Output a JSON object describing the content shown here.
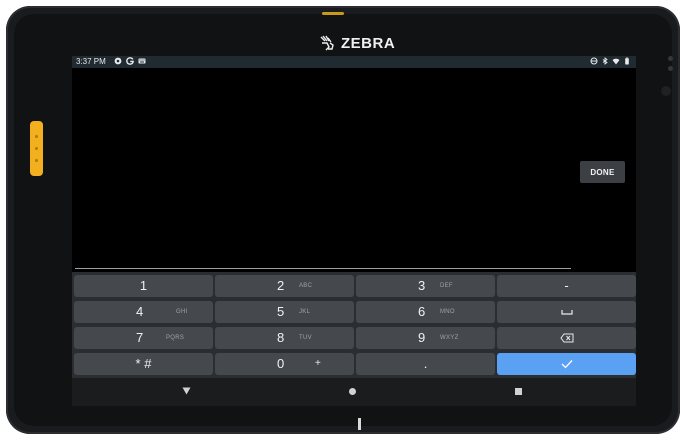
{
  "device": {
    "brand": "ZEBRA"
  },
  "statusbar": {
    "time": "3:37 PM",
    "left_icons": [
      "settings-gear-icon",
      "google-g-icon",
      "keyboard-icon"
    ],
    "right_icons": [
      "data-sync-icon",
      "bluetooth-icon",
      "wifi-icon",
      "battery-icon"
    ]
  },
  "app": {
    "done_label": "DONE"
  },
  "keyboard": {
    "rows": [
      [
        {
          "main": "1",
          "sub": ""
        },
        {
          "main": "2",
          "sub": "ABC"
        },
        {
          "main": "3",
          "sub": "DEF"
        },
        {
          "main": "-",
          "sub": ""
        }
      ],
      [
        {
          "main": "4",
          "sub": "GHI"
        },
        {
          "main": "5",
          "sub": "JKL"
        },
        {
          "main": "6",
          "sub": "MNO"
        },
        {
          "main": "",
          "sub": "",
          "icon": "space-bar-icon"
        }
      ],
      [
        {
          "main": "7",
          "sub": "PQRS"
        },
        {
          "main": "8",
          "sub": "TUV"
        },
        {
          "main": "9",
          "sub": "WXYZ"
        },
        {
          "main": "",
          "sub": "",
          "icon": "backspace-icon"
        }
      ],
      [
        {
          "main": "* #",
          "sub": ""
        },
        {
          "main": "0",
          "sub": "+"
        },
        {
          "main": ".",
          "sub": ""
        },
        {
          "main": "",
          "sub": "",
          "icon": "checkmark-icon"
        }
      ]
    ],
    "accent_color": "#5ba1f3"
  },
  "navbar": {
    "icons": [
      "back-icon",
      "home-icon",
      "recents-icon"
    ]
  }
}
